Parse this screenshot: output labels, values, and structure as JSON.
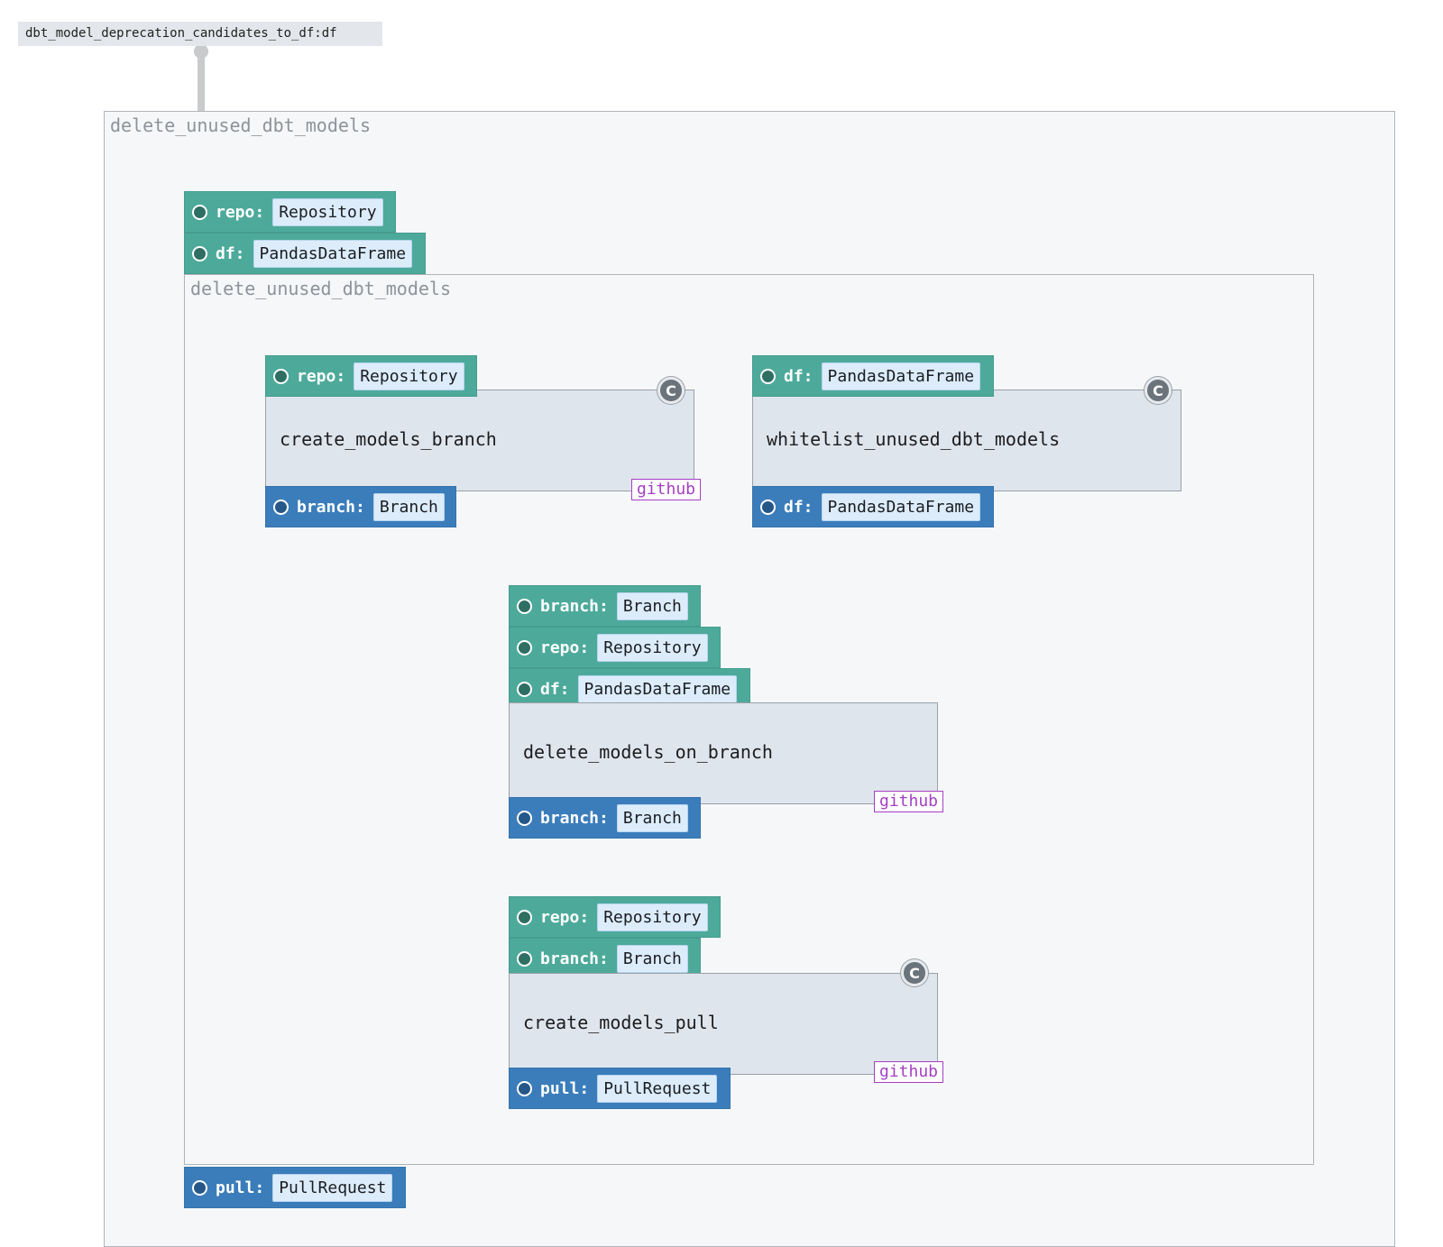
{
  "source": {
    "label": "dbt_model_deprecation_candidates_to_df:df"
  },
  "outer_group": {
    "title": "delete_unused_dbt_models",
    "inputs": [
      {
        "name": "repo:",
        "type": "Repository"
      },
      {
        "name": "df:",
        "type": "PandasDataFrame"
      }
    ],
    "outputs": [
      {
        "name": "pull:",
        "type": "PullRequest"
      }
    ]
  },
  "inner_group": {
    "title": "delete_unused_dbt_models"
  },
  "ops": {
    "create_models_branch": {
      "name": "create_models_branch",
      "tag": "github",
      "badge": "C",
      "inputs": [
        {
          "name": "repo:",
          "type": "Repository"
        }
      ],
      "outputs": [
        {
          "name": "branch:",
          "type": "Branch"
        }
      ]
    },
    "whitelist_unused_dbt_models": {
      "name": "whitelist_unused_dbt_models",
      "badge": "C",
      "inputs": [
        {
          "name": "df:",
          "type": "PandasDataFrame"
        }
      ],
      "outputs": [
        {
          "name": "df:",
          "type": "PandasDataFrame"
        }
      ]
    },
    "delete_models_on_branch": {
      "name": "delete_models_on_branch",
      "tag": "github",
      "inputs": [
        {
          "name": "branch:",
          "type": "Branch"
        },
        {
          "name": "repo:",
          "type": "Repository"
        },
        {
          "name": "df:",
          "type": "PandasDataFrame"
        }
      ],
      "outputs": [
        {
          "name": "branch:",
          "type": "Branch"
        }
      ]
    },
    "create_models_pull": {
      "name": "create_models_pull",
      "tag": "github",
      "badge": "C",
      "inputs": [
        {
          "name": "repo:",
          "type": "Repository"
        },
        {
          "name": "branch:",
          "type": "Branch"
        }
      ],
      "outputs": [
        {
          "name": "pull:",
          "type": "PullRequest"
        }
      ]
    }
  },
  "colors": {
    "input_port": "#4daa9b",
    "output_port": "#3b7dbb",
    "tag": "#a43fc4",
    "edge": "#c8cacc",
    "mapping_edge": "#cde8e3"
  },
  "icons": {
    "port": "circle-icon",
    "composite_badge": "composite-c-icon"
  }
}
